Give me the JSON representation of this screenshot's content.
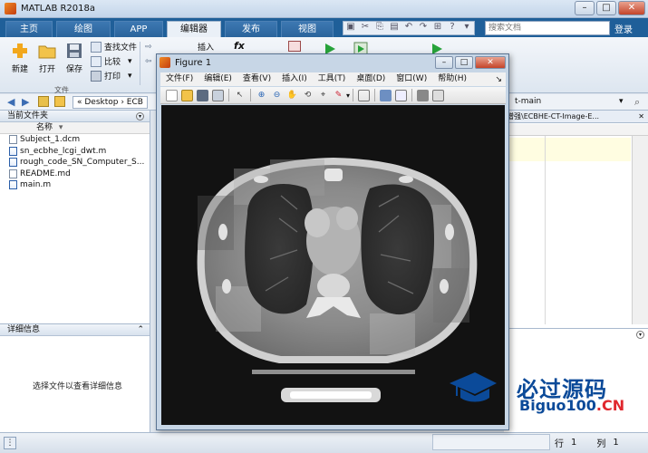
{
  "window": {
    "title": "MATLAB R2018a"
  },
  "ribbon": {
    "tabs": [
      {
        "label": "主页"
      },
      {
        "label": "绘图"
      },
      {
        "label": "APP"
      },
      {
        "label": "编辑器"
      },
      {
        "label": "发布"
      },
      {
        "label": "视图"
      }
    ],
    "active_tab": "编辑器",
    "search_placeholder": "搜索文档",
    "login_label": "登录"
  },
  "toolstrip": {
    "new_label": "新建",
    "open_label": "打开",
    "save_label": "保存",
    "find_files_label": "查找文件",
    "compare_label": "比较",
    "print_label": "打印",
    "insert_label": "插入",
    "section_label": "文件"
  },
  "address": {
    "path": "« Desktop › ECB",
    "editor_path_suffix": "t-main"
  },
  "current_folder": {
    "title": "当前文件夹",
    "column_name": "名称",
    "files": [
      {
        "name": "Subject_1.dcm",
        "type": "file"
      },
      {
        "name": "sn_ecbhe_lcgi_dwt.m",
        "type": "m"
      },
      {
        "name": "rough_code_SN_Computer_S...",
        "type": "m"
      },
      {
        "name": "README.md",
        "type": "file"
      },
      {
        "name": "main.m",
        "type": "m"
      }
    ]
  },
  "details": {
    "title": "详细信息",
    "message": "选择文件以查看详细信息"
  },
  "editor": {
    "tab_label": "增强\\ECBHE-CT-Image-E..."
  },
  "status": {
    "line_label": "行",
    "line_value": "1",
    "col_label": "列",
    "col_value": "1"
  },
  "figure": {
    "title": "Figure 1",
    "menu": [
      {
        "label": "文件(F)"
      },
      {
        "label": "编辑(E)"
      },
      {
        "label": "查看(V)"
      },
      {
        "label": "插入(I)"
      },
      {
        "label": "工具(T)"
      },
      {
        "label": "桌面(D)"
      },
      {
        "label": "窗口(W)"
      },
      {
        "label": "帮助(H)"
      }
    ]
  },
  "watermark": {
    "line1": "必过源码",
    "line2_main": "Biguo100",
    "line2_suffix": ".CN",
    "color": "#0b4a99",
    "accent": "#e0282e"
  },
  "colors": {
    "ribbon_blue": "#1f5f99",
    "panel_bg": "#ffffff",
    "canvas_bg": "#111111"
  }
}
